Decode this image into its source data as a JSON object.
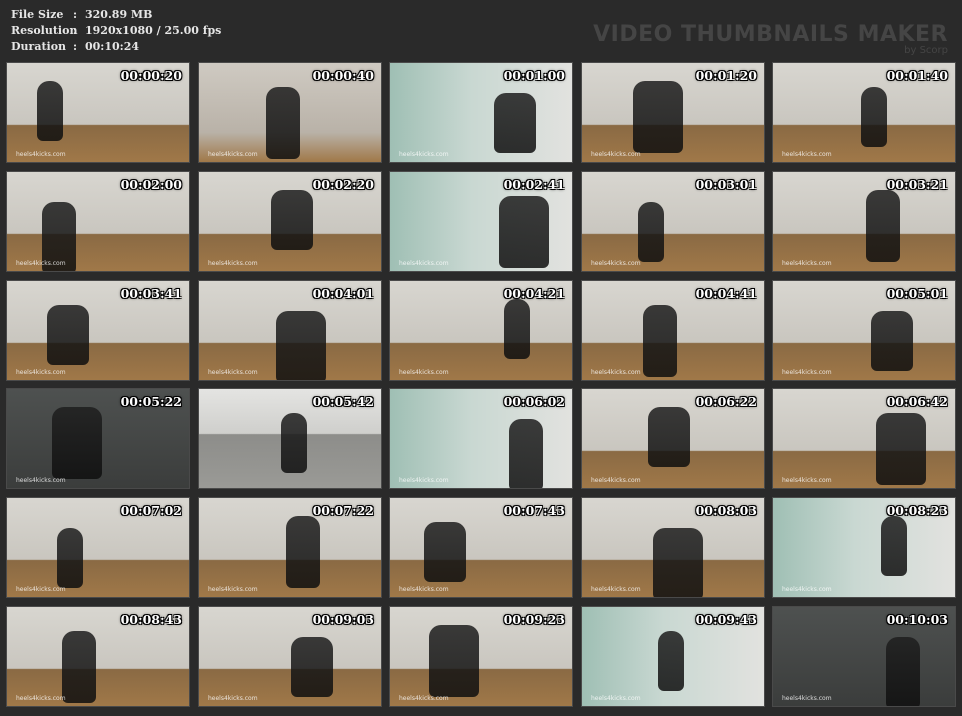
{
  "header": {
    "file_size_label": "File Size",
    "file_size_value": "320.89 MB",
    "resolution_label": "Resolution",
    "resolution_value": "1920x1080 / 25.00 fps",
    "duration_label": "Duration",
    "duration_value": "00:10:24",
    "separator": ":",
    "watermark_title": "VIDEO THUMBNAILS MAKER",
    "watermark_by": "by Scorp"
  },
  "thumbnails": [
    {
      "time": "00:00:20",
      "watermark": "heels4kicks.com",
      "scene": "room"
    },
    {
      "time": "00:00:40",
      "watermark": "heels4kicks.com",
      "scene": "closeup"
    },
    {
      "time": "00:01:00",
      "watermark": "heels4kicks.com",
      "scene": "teal"
    },
    {
      "time": "00:01:20",
      "watermark": "heels4kicks.com",
      "scene": "room"
    },
    {
      "time": "00:01:40",
      "watermark": "heels4kicks.com",
      "scene": "room"
    },
    {
      "time": "00:02:00",
      "watermark": "heels4kicks.com",
      "scene": "room"
    },
    {
      "time": "00:02:20",
      "watermark": "heels4kicks.com",
      "scene": "room"
    },
    {
      "time": "00:02:41",
      "watermark": "heels4kicks.com",
      "scene": "teal"
    },
    {
      "time": "00:03:01",
      "watermark": "heels4kicks.com",
      "scene": "room"
    },
    {
      "time": "00:03:21",
      "watermark": "heels4kicks.com",
      "scene": "room"
    },
    {
      "time": "00:03:41",
      "watermark": "heels4kicks.com",
      "scene": "room"
    },
    {
      "time": "00:04:01",
      "watermark": "heels4kicks.com",
      "scene": "room"
    },
    {
      "time": "00:04:21",
      "watermark": "heels4kicks.com",
      "scene": "room"
    },
    {
      "time": "00:04:41",
      "watermark": "heels4kicks.com",
      "scene": "room"
    },
    {
      "time": "00:05:01",
      "watermark": "heels4kicks.com",
      "scene": "room"
    },
    {
      "time": "00:05:22",
      "watermark": "heels4kicks.com",
      "scene": "dark"
    },
    {
      "time": "00:05:42",
      "watermark": "",
      "scene": "floor"
    },
    {
      "time": "00:06:02",
      "watermark": "heels4kicks.com",
      "scene": "teal"
    },
    {
      "time": "00:06:22",
      "watermark": "heels4kicks.com",
      "scene": "room"
    },
    {
      "time": "00:06:42",
      "watermark": "heels4kicks.com",
      "scene": "room"
    },
    {
      "time": "00:07:02",
      "watermark": "heels4kicks.com",
      "scene": "room"
    },
    {
      "time": "00:07:22",
      "watermark": "heels4kicks.com",
      "scene": "room"
    },
    {
      "time": "00:07:43",
      "watermark": "heels4kicks.com",
      "scene": "room"
    },
    {
      "time": "00:08:03",
      "watermark": "heels4kicks.com",
      "scene": "room"
    },
    {
      "time": "00:08:23",
      "watermark": "heels4kicks.com",
      "scene": "teal"
    },
    {
      "time": "00:08:43",
      "watermark": "heels4kicks.com",
      "scene": "room"
    },
    {
      "time": "00:09:03",
      "watermark": "heels4kicks.com",
      "scene": "room"
    },
    {
      "time": "00:09:23",
      "watermark": "heels4kicks.com",
      "scene": "room"
    },
    {
      "time": "00:09:43",
      "watermark": "heels4kicks.com",
      "scene": "teal"
    },
    {
      "time": "00:10:03",
      "watermark": "heels4kicks.com",
      "scene": "dark"
    }
  ],
  "colors": {
    "background": "#2a2a2a",
    "text": "#e6e6e6",
    "watermark": "#454545",
    "thumb_border": "#4a4a4a"
  }
}
